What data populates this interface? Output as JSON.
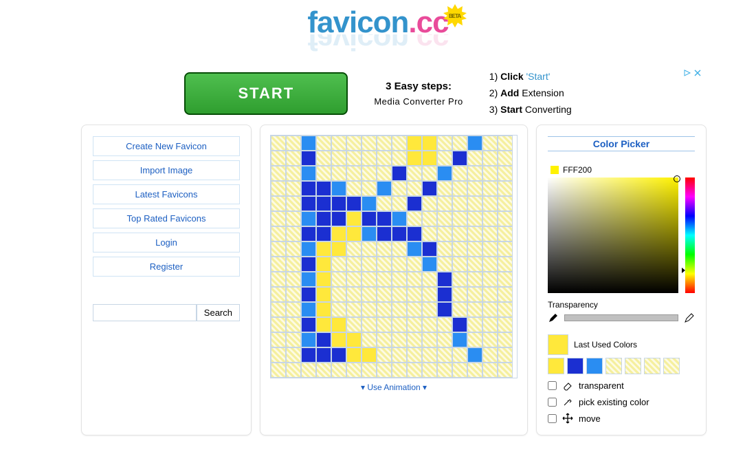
{
  "logo": {
    "a": "favicon",
    "b": "cc",
    "beta": "BETA"
  },
  "ad": {
    "start": "START",
    "heading": "3 Easy steps:",
    "sub": "Media Converter Pro",
    "steps": [
      {
        "n": "1)",
        "b": "Click",
        "rest": "",
        "link": "'Start'"
      },
      {
        "n": "2)",
        "b": "Add",
        "rest": "Extension",
        "link": ""
      },
      {
        "n": "3)",
        "b": "Start",
        "rest": "Converting",
        "link": ""
      }
    ]
  },
  "nav": [
    "Create New Favicon",
    "Import Image",
    "Latest Favicons",
    "Top Rated Favicons",
    "Login",
    "Register"
  ],
  "search_btn": "Search",
  "use_animation": "Use Animation",
  "picker": {
    "title": "Color Picker",
    "hex": "FFF200",
    "current_rgb": "#fff200",
    "hue_pos_pct": 78,
    "transparency_label": "Transparency",
    "last_used_label": "Last Used Colors",
    "last_used": [
      "#ffe83b",
      "#1b2fd1",
      "#2a8df2",
      "tr",
      "tr",
      "tr",
      "tr"
    ],
    "tools": {
      "transparent": "transparent",
      "pick": "pick existing color",
      "move": "move"
    }
  },
  "grid": {
    "size": 16,
    "colors": {
      "1": "#1b2fd1",
      "2": "#2a8df2",
      "3": "#ffe83b"
    },
    "cells": [
      [
        0,
        0,
        2,
        0,
        0,
        0,
        0,
        0,
        0,
        3,
        3,
        0,
        0,
        2,
        0,
        0
      ],
      [
        0,
        0,
        1,
        0,
        0,
        0,
        0,
        0,
        0,
        3,
        3,
        0,
        1,
        0,
        0,
        0
      ],
      [
        0,
        0,
        2,
        0,
        0,
        0,
        0,
        0,
        1,
        0,
        0,
        2,
        0,
        0,
        0,
        0
      ],
      [
        0,
        0,
        1,
        1,
        2,
        0,
        0,
        2,
        0,
        0,
        1,
        0,
        0,
        0,
        0,
        0
      ],
      [
        0,
        0,
        1,
        1,
        1,
        1,
        2,
        0,
        0,
        1,
        0,
        0,
        0,
        0,
        0,
        0
      ],
      [
        0,
        0,
        2,
        1,
        1,
        3,
        1,
        1,
        2,
        0,
        0,
        0,
        0,
        0,
        0,
        0
      ],
      [
        0,
        0,
        1,
        1,
        3,
        3,
        2,
        1,
        1,
        1,
        0,
        0,
        0,
        0,
        0,
        0
      ],
      [
        0,
        0,
        2,
        3,
        3,
        0,
        0,
        0,
        0,
        2,
        1,
        0,
        0,
        0,
        0,
        0
      ],
      [
        0,
        0,
        1,
        3,
        0,
        0,
        0,
        0,
        0,
        0,
        2,
        0,
        0,
        0,
        0,
        0
      ],
      [
        0,
        0,
        2,
        3,
        0,
        0,
        0,
        0,
        0,
        0,
        0,
        1,
        0,
        0,
        0,
        0
      ],
      [
        0,
        0,
        1,
        3,
        0,
        0,
        0,
        0,
        0,
        0,
        0,
        1,
        0,
        0,
        0,
        0
      ],
      [
        0,
        0,
        2,
        3,
        0,
        0,
        0,
        0,
        0,
        0,
        0,
        1,
        0,
        0,
        0,
        0
      ],
      [
        0,
        0,
        1,
        3,
        3,
        0,
        0,
        0,
        0,
        0,
        0,
        0,
        1,
        0,
        0,
        0
      ],
      [
        0,
        0,
        2,
        1,
        3,
        3,
        0,
        0,
        0,
        0,
        0,
        0,
        2,
        0,
        0,
        0
      ],
      [
        0,
        0,
        1,
        1,
        1,
        3,
        3,
        0,
        0,
        0,
        0,
        0,
        0,
        2,
        0,
        0
      ],
      [
        0,
        0,
        0,
        0,
        0,
        0,
        0,
        0,
        0,
        0,
        0,
        0,
        0,
        0,
        0,
        0
      ]
    ]
  }
}
